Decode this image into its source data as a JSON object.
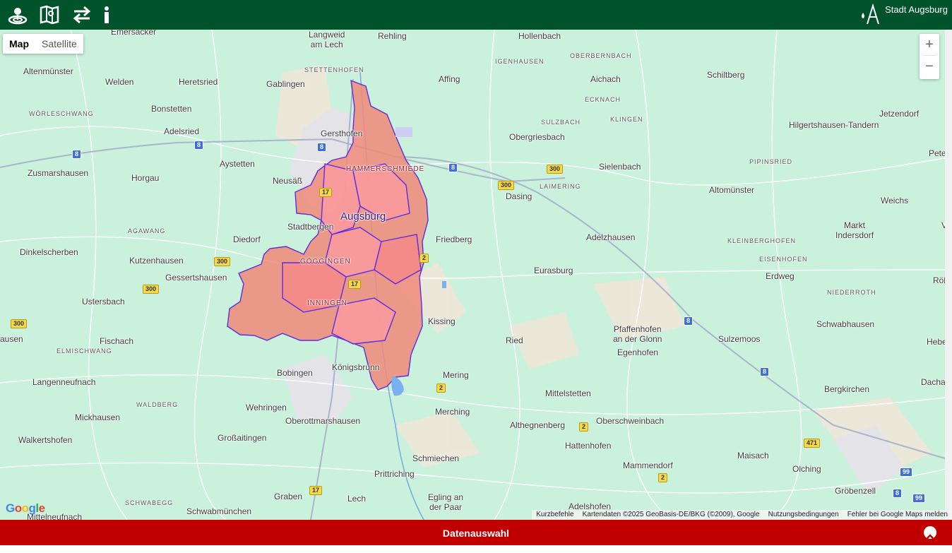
{
  "header": {
    "icons": [
      "geoinfo-icon",
      "map-book-icon",
      "swap-arrows-icon",
      "info-icon"
    ],
    "brand": "Stadt Augsburg",
    "brand_color": "#00532a"
  },
  "map": {
    "type_control": {
      "map": "Map",
      "satellite": "Satellite",
      "selected": "Map"
    },
    "zoom": {
      "in": "+",
      "out": "−"
    },
    "highlight_fill": "#f08a7a",
    "highlight_stroke": "#5b2de0",
    "google": "Google",
    "attribution": {
      "shortcuts": "Kurzbefehle",
      "data": "Kartendaten ©2025 GeoBasis-DE/BKG (©2009), Google",
      "terms": "Nutzungsbedingungen",
      "report": "Fehler bei Google Maps melden"
    },
    "places": [
      {
        "n": "Langweid\nam Lech"
      },
      {
        "n": "Rehling"
      },
      {
        "n": "Hollenbach"
      },
      {
        "n": "OBERBERNBACH"
      },
      {
        "n": "Altenmünster"
      },
      {
        "n": "Welden"
      },
      {
        "n": "Heretsried"
      },
      {
        "n": "Gablingen"
      },
      {
        "n": "STETTENHOFEN"
      },
      {
        "n": "Affing"
      },
      {
        "n": "IGENHAUSEN"
      },
      {
        "n": "Aichach"
      },
      {
        "n": "Schiltberg"
      },
      {
        "n": "WÖRLESCHWANG"
      },
      {
        "n": "Bonstetten"
      },
      {
        "n": "ECKNACH"
      },
      {
        "n": "SULZBACH"
      },
      {
        "n": "KLINGEN"
      },
      {
        "n": "Jetzendorf"
      },
      {
        "n": "Adelsried"
      },
      {
        "n": "Gersthofen"
      },
      {
        "n": "Obergriesbach"
      },
      {
        "n": "Hilgertshausen-Tandern"
      },
      {
        "n": "Zusmarshausen"
      },
      {
        "n": "Aystetten"
      },
      {
        "n": "HAMMERSCHMIEDE"
      },
      {
        "n": "PIPINSRIED"
      },
      {
        "n": "Sielenbach"
      },
      {
        "n": "Horgau"
      },
      {
        "n": "Neusäß"
      },
      {
        "n": "LAIMERING"
      },
      {
        "n": "Dasing"
      },
      {
        "n": "Altomünster"
      },
      {
        "n": "Augsburg"
      },
      {
        "n": "Weichs"
      },
      {
        "n": "AGAWANG"
      },
      {
        "n": "Stadtbergen"
      },
      {
        "n": "Friedberg"
      },
      {
        "n": "Adelzhausen"
      },
      {
        "n": "Markt\nIndersdorf"
      },
      {
        "n": "Dinkelscherben"
      },
      {
        "n": "Diedorf"
      },
      {
        "n": "KLEINBERGHOFEN"
      },
      {
        "n": "Kutzenhausen"
      },
      {
        "n": "GÖGGINGEN"
      },
      {
        "n": "EISENHOFEN"
      },
      {
        "n": "Eurasburg"
      },
      {
        "n": "Gessertshausen"
      },
      {
        "n": "Erdweg"
      },
      {
        "n": "NIEDERROTH"
      },
      {
        "n": "Ustersbach"
      },
      {
        "n": "INNINGEN"
      },
      {
        "n": "Kissing"
      },
      {
        "n": "Schwabhausen"
      },
      {
        "n": "Pfaffenhofen\nan der Glonn"
      },
      {
        "n": "Fischach"
      },
      {
        "n": "Ried"
      },
      {
        "n": "Sulzemoos"
      },
      {
        "n": "ELMISCHWANG"
      },
      {
        "n": "Egenhofen"
      },
      {
        "n": "Königsbrunn"
      },
      {
        "n": "Bobingen"
      },
      {
        "n": "Mering"
      },
      {
        "n": "Langenneufnach"
      },
      {
        "n": "Dachau"
      },
      {
        "n": "Bergkirchen"
      },
      {
        "n": "WALDBERG"
      },
      {
        "n": "Wehringen"
      },
      {
        "n": "Mittelstetten"
      },
      {
        "n": "Merching"
      },
      {
        "n": "Mickhausen"
      },
      {
        "n": "Oberottmarshausen"
      },
      {
        "n": "Althegnenberg"
      },
      {
        "n": "Oberschweinbach"
      },
      {
        "n": "Walkertshofen"
      },
      {
        "n": "Großaitingen"
      },
      {
        "n": "Hattenhofen"
      },
      {
        "n": "Maisach"
      },
      {
        "n": "Schmiechen"
      },
      {
        "n": "Mammendorf"
      },
      {
        "n": "Olching"
      },
      {
        "n": "Prittriching"
      },
      {
        "n": "Gröbenzell"
      },
      {
        "n": "SCHWABEGG"
      },
      {
        "n": "Graben"
      },
      {
        "n": "Egling an\nder Paar"
      },
      {
        "n": "Schwabmünchen"
      },
      {
        "n": "Adelshofen"
      },
      {
        "n": "Mittelneufnach"
      },
      {
        "n": "Lech"
      },
      {
        "n": "Emersacker"
      },
      {
        "n": "ausen"
      },
      {
        "n": "Pete"
      },
      {
        "n": "Vierkir"
      },
      {
        "n": "Röhrmoo"
      },
      {
        "n": "Hebe"
      }
    ],
    "shields": [
      "8",
      "8",
      "8",
      "8",
      "8",
      "8",
      "8",
      "300",
      "300",
      "300",
      "300",
      "300",
      "300",
      "17",
      "17",
      "17",
      "2",
      "2",
      "2",
      "2",
      "2",
      "471",
      "99",
      "99"
    ]
  },
  "bottom": {
    "label": "Datenauswahl",
    "bar_color": "#c00000"
  }
}
